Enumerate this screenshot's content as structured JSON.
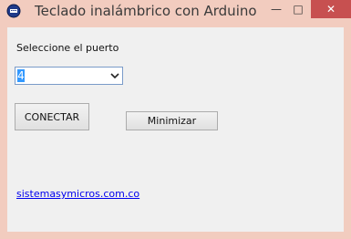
{
  "window": {
    "title": "Teclado inalámbrico con Arduino",
    "controls": {
      "minimize_glyph": "—",
      "maximize_glyph": "□",
      "close_glyph": "✕"
    },
    "app_icon": "app-icon",
    "colors": {
      "titlebar": "#f2ccbf",
      "close": "#c75050",
      "client": "#f0f0f0"
    }
  },
  "form": {
    "port_label": "Seleccione el puerto",
    "port_select": {
      "selected": "4",
      "icon": "chevron-down-icon"
    },
    "connect_button": "CONECTAR",
    "minimize_button": "Minimizar",
    "link_text": "sistemasymicros.com.co"
  }
}
